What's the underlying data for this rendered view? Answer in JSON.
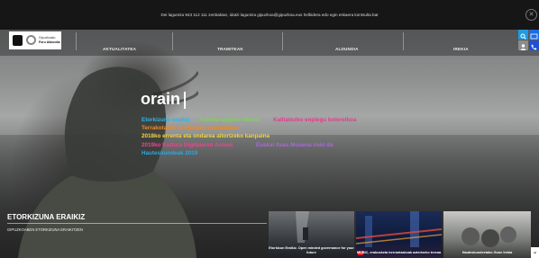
{
  "topbar": {
    "message": "Dei laguntza 943 112 111 zenbakian, idatzi laguntza gipuzkoa@gipuzkoa.eus helbidera edo egin eskaera kontsulta bat"
  },
  "logo": {
    "line1": "Gipuzkoako",
    "line2": "Foru Aldundia"
  },
  "nav": {
    "items": [
      "AKTUALITATEA",
      "TRAMITEAK",
      "ALDUNDIA",
      "IREKIA"
    ]
  },
  "hero": {
    "heading": "orain",
    "taglines": [
      {
        "text": "Etorkizuna eraikiz",
        "color": "#29b8e8"
      },
      {
        "text": "Familia ugarien Mulua",
        "color": "#79d84f"
      },
      {
        "text": "Kalitatezko enplegu kolorelkoa",
        "color": "#e23d8c"
      },
      {
        "text": "Terrakotazko soldaduen erakusketa",
        "color": "#f08a24"
      },
      {
        "text": "2018ko errenta eta ondarea aitortzeko kanpaina",
        "color": "#f5d83a"
      },
      {
        "text": "2019ko Kultura Digitalaren Asteak",
        "color": "#e9468e"
      },
      {
        "text": "Euskal Itsas Museoa ireki da",
        "color": "#a66ad9"
      },
      {
        "text": "Hauteskundeak 2019",
        "color": "#2ea8e2"
      }
    ]
  },
  "section": {
    "title": "ETORKIZUNA ERAIKIZ",
    "subtitle": "GIPUZKOABEN ETORKIZUNA ERAIKITZEN"
  },
  "thumbnails": [
    {
      "caption": "Etorkizun Eraikiz. Open minded governance for your future"
    },
    {
      "caption": "MUBIC, erakusketa berrantzakoak aztertzeko tresna"
    },
    {
      "caption": "Hauteskundeetako Gune Irekia"
    }
  ],
  "colors": {
    "topbar": "#161616",
    "accent_blue": "#1e6be0"
  }
}
